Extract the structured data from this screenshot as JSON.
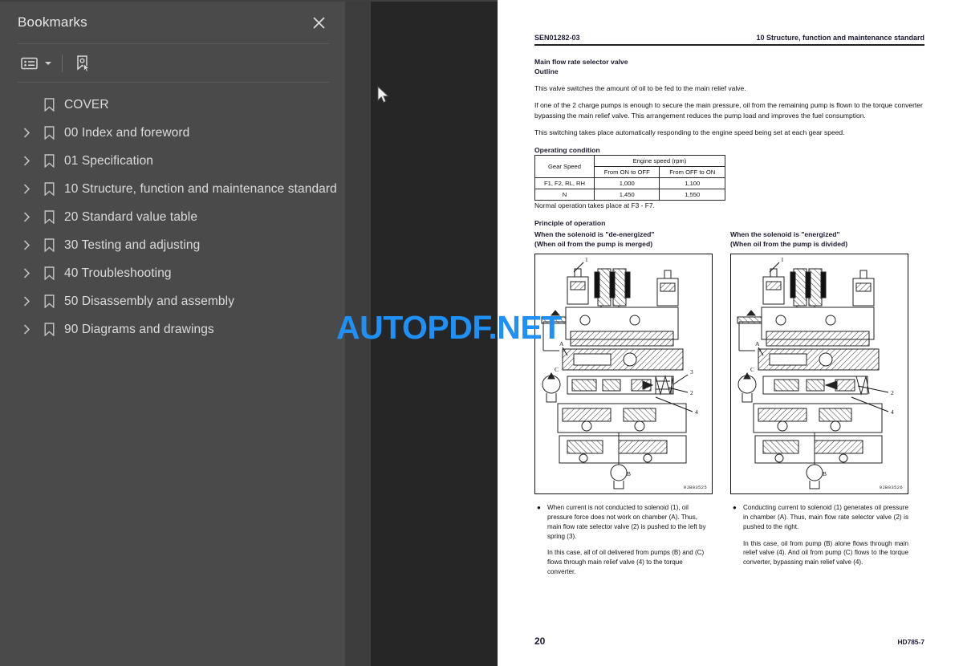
{
  "sidebar": {
    "title": "Bookmarks",
    "close_icon": "close-icon",
    "toolbar": {
      "list_options_icon": "list-options-icon",
      "dropdown_icon": "chevron-down-icon",
      "bookmark_select_icon": "bookmark-pointer-icon"
    },
    "items": [
      {
        "label": "COVER",
        "expandable": false
      },
      {
        "label": "00 Index and foreword",
        "expandable": true
      },
      {
        "label": "01 Specification",
        "expandable": true
      },
      {
        "label": "10 Structure, function and maintenance standard",
        "expandable": true
      },
      {
        "label": "20 Standard value table",
        "expandable": true
      },
      {
        "label": "30 Testing and adjusting",
        "expandable": true
      },
      {
        "label": "40 Troubleshooting",
        "expandable": true
      },
      {
        "label": "50 Disassembly and assembly",
        "expandable": true
      },
      {
        "label": "90 Diagrams and drawings",
        "expandable": true
      }
    ]
  },
  "watermark": {
    "text": "AUTOPDF.NET",
    "color": "#1e90f6"
  },
  "document": {
    "header": {
      "doc_number": "SEN01282-03",
      "section": "10 Structure, function and maintenance standard"
    },
    "title": "Main flow rate selector valve",
    "outline_heading": "Outline",
    "paragraphs": [
      "This valve switches the amount of oil to be fed to the main relief valve.",
      "If one of the 2 charge pumps is enough to secure the main pressure, oil from the remaining pump is flown to the torque converter bypassing the main relief valve. This arrangement reduces the pump load and improves the fuel consumption.",
      "This switching takes place automatically responding to the engine speed being set at each gear speed."
    ],
    "operating_condition": {
      "heading": "Operating condition",
      "col_gear": "Gear Speed",
      "col_engine_speed": "Engine speed (rpm)",
      "col_on_to_off": "From ON to OFF",
      "col_off_to_on": "From OFF to ON",
      "rows": [
        {
          "gear": "F1, F2, RL, RH",
          "on_to_off": "1,000",
          "off_to_on": "1,100"
        },
        {
          "gear": "N",
          "on_to_off": "1,450",
          "off_to_on": "1,550"
        }
      ],
      "note": "Normal operation takes place at F3 - F7."
    },
    "principle_heading": "Principle of operation",
    "columns": [
      {
        "head_line1": "When the solenoid is \"de-energized\"",
        "head_line2": "(When oil from the pump is merged)",
        "figure_id": "9JB03525",
        "bullet": "●",
        "body1": "When current is not conducted to solenoid (1), oil pressure force does not work on chamber (A). Thus, main flow rate selector valve (2) is pushed to the left by spring (3).",
        "body2": "In this case, all of oil delivered from pumps (B) and (C) flows through main relief valve (4) to the torque converter."
      },
      {
        "head_line1": "When the solenoid is \"energized\"",
        "head_line2": "(When oil from the pump is divided)",
        "figure_id": "9JB03526",
        "bullet": "●",
        "body1": "Conducting current to solenoid (1) generates oil pressure in chamber (A). Thus, main flow rate selector valve (2) is pushed to the right.",
        "body2": "In this case, oil from pump (B) alone flows through main relief valve (4). And oil from pump (C) flows to the torque converter, bypassing main relief valve (4)."
      }
    ],
    "footer": {
      "page_number": "20",
      "model": "HD785-7"
    }
  }
}
